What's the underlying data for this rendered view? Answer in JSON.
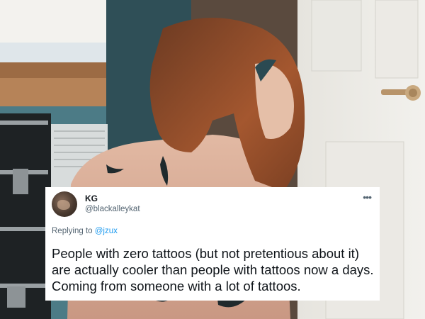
{
  "tweet": {
    "display_name": "KG",
    "handle": "@blackalleykat",
    "reply_prefix": "Replying to",
    "reply_to": "@jzux",
    "text": "People with zero tattoos (but not pretentious about it) are actually cooler than people with tattoos now a days. Coming from someone with a lot of tattoos.",
    "more_icon": "more-icon"
  },
  "colors": {
    "text_primary": "#0f1419",
    "text_secondary": "#536471",
    "link": "#1d9bf0",
    "card_bg": "#ffffff"
  }
}
